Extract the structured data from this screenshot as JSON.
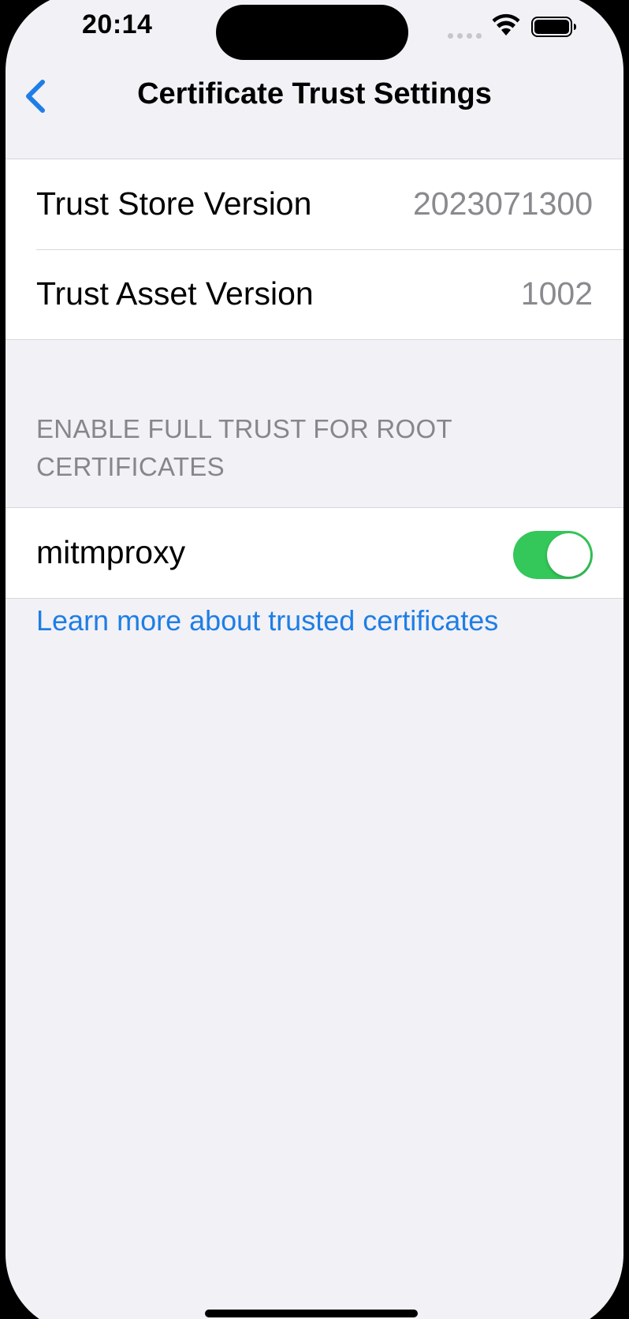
{
  "status_bar": {
    "time": "20:14"
  },
  "nav": {
    "title": "Certificate Trust Settings",
    "back_icon": "chevron-left-icon"
  },
  "versions": {
    "trust_store_label": "Trust Store Version",
    "trust_store_value": "2023071300",
    "trust_asset_label": "Trust Asset Version",
    "trust_asset_value": "1002"
  },
  "root_certs": {
    "section_header": "ENABLE FULL TRUST FOR ROOT CERTIFICATES",
    "items": [
      {
        "label": "mitmproxy",
        "enabled": true
      }
    ]
  },
  "footer": {
    "learn_more": "Learn more about trusted certificates"
  },
  "colors": {
    "accent": "#1e7ee6",
    "toggle_on": "#34c759",
    "background": "#f2f1f6"
  }
}
